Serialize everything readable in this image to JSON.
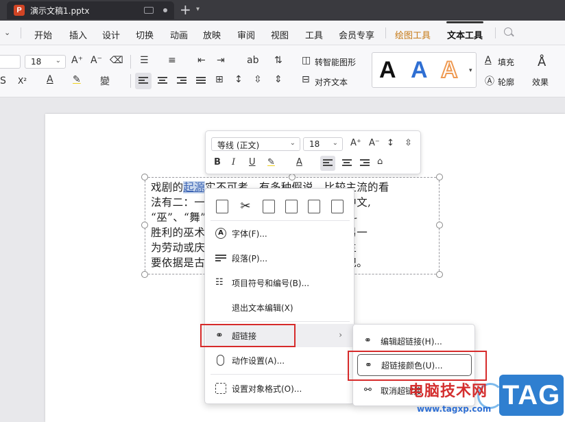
{
  "titlebar": {
    "doc_tab_title": "演示文稿1.pptx",
    "app_icon_letter": "P",
    "new_tab_symbol": "+"
  },
  "menubar": {
    "items": [
      "开始",
      "插入",
      "设计",
      "切换",
      "动画",
      "放映",
      "审阅",
      "视图",
      "工具",
      "会员专享",
      "绘图工具",
      "文本工具"
    ],
    "active": "文本工具"
  },
  "ribbon": {
    "font_size": "18",
    "smart_shape_label": "转智能图形",
    "align_text_label": "对齐文本",
    "fill_label": "填充",
    "outline_label": "轮廓",
    "effect_label": "效果",
    "style_sample": "A",
    "superscript_label": "X²"
  },
  "mini_toolbar": {
    "font_name": "等线 (正文)",
    "font_size": "18"
  },
  "slide_text": {
    "line1_a": "戏剧的",
    "line1_hl": "起源",
    "line1_b": "实不可考，有多种假说，比较主流的看",
    "line2": "法有二：一是起源于宗教仪式，比如上古中文,",
    "line3": "“巫”、“舞”同源，巫师舞蹈是一种乞求战斗",
    "line4": "胜利的巫术，也可视为戏剧的原始形态。另一",
    "line5": "为劳动或庆典说，古希腊戏剧，这种说法主",
    "line6": "要依据是古希腊的戏剧普遍起源于酒神祭祀。"
  },
  "context_menu": {
    "font": "字体(F)...",
    "paragraph": "段落(P)...",
    "bullets": "项目符号和编号(B)...",
    "exit_edit": "退出文本编辑(X)",
    "hyperlink": "超链接",
    "action": "动作设置(A)...",
    "format": "设置对象格式(O)..."
  },
  "submenu": {
    "edit": "编辑超链接(H)...",
    "color": "超链接颜色(U)...",
    "cancel": "取消超链接"
  },
  "watermark": {
    "site_name": "电脑技术网",
    "url": "www.tagxp.com",
    "tag": "TAG"
  },
  "colors": {
    "highlight_red": "#d62a2a",
    "draw_tools": "#c67a17",
    "text_style_blue": "#2f6fd3"
  }
}
